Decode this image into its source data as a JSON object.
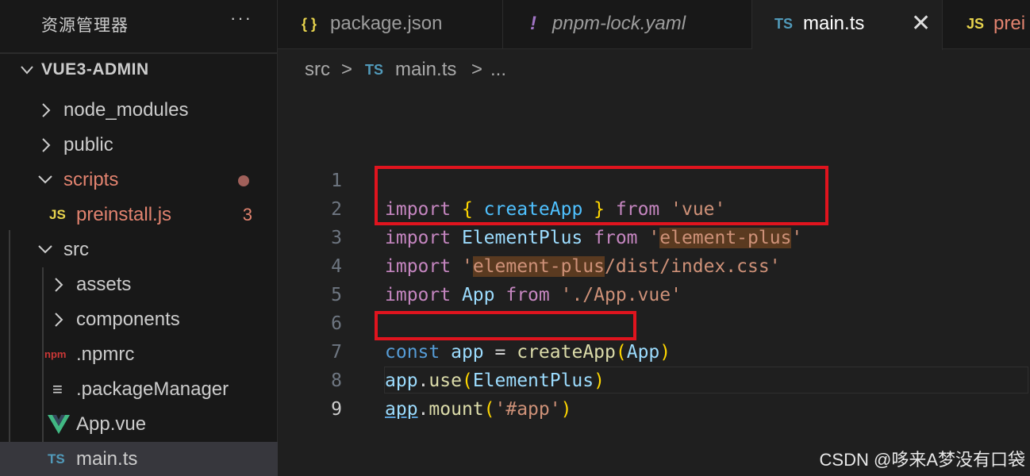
{
  "sidebar": {
    "title": "资源管理器",
    "more": "···",
    "project": "VUE3-ADMIN",
    "items": [
      {
        "label": "node_modules",
        "type": "folder",
        "open": false,
        "depth": 1
      },
      {
        "label": "public",
        "type": "folder",
        "open": false,
        "depth": 1
      },
      {
        "label": "scripts",
        "type": "folder",
        "open": true,
        "depth": 1,
        "modified": true
      },
      {
        "label": "preinstall.js",
        "type": "file",
        "icon": "JS",
        "depth": 2,
        "count": "3"
      },
      {
        "label": "src",
        "type": "folder",
        "open": true,
        "depth": 1
      },
      {
        "label": "assets",
        "type": "folder",
        "open": false,
        "depth": 2
      },
      {
        "label": "components",
        "type": "folder",
        "open": false,
        "depth": 2
      },
      {
        "label": ".npmrc",
        "type": "file",
        "icon": "npm",
        "depth": 2
      },
      {
        "label": ".packageManager",
        "type": "file",
        "icon": "≡",
        "depth": 2
      },
      {
        "label": "App.vue",
        "type": "file",
        "icon": "vue",
        "depth": 2
      },
      {
        "label": "main.ts",
        "type": "file",
        "icon": "TS",
        "depth": 2,
        "selected": true
      }
    ]
  },
  "tabs": [
    {
      "icon": "{ }",
      "label": "package.json"
    },
    {
      "icon": "!",
      "label": "pnpm-lock.yaml"
    },
    {
      "icon": "TS",
      "label": "main.ts",
      "active": true,
      "close": "✕"
    },
    {
      "icon": "JS",
      "label": "prei"
    }
  ],
  "breadcrumb": {
    "part1": "src",
    "sep": ">",
    "icon": "TS",
    "part2": "main.ts",
    "part3": "..."
  },
  "editor": {
    "line_numbers": [
      "1",
      "2",
      "3",
      "4",
      "5",
      "6",
      "7",
      "8",
      "9"
    ],
    "current_line": "9",
    "lines": {
      "l1": {
        "a": "import",
        "b": "{",
        "c": "createApp",
        "d": "}",
        "e": "from",
        "f": "'vue'"
      },
      "l2": {
        "a": "import",
        "b": "ElementPlus",
        "c": "from",
        "d": "'",
        "e": "element-plus",
        "f": "'"
      },
      "l3": {
        "a": "import",
        "b": "'",
        "c": "element-plus",
        "d": "/dist/index.css'"
      },
      "l4": {
        "a": "import",
        "b": "App",
        "c": "from",
        "d": "'./App.vue'"
      },
      "l6": {
        "a": "const",
        "b": "app",
        "c": "=",
        "d": "createApp",
        "e": "(",
        "f": "App",
        "g": ")"
      },
      "l7": {
        "a": "app",
        "b": ".",
        "c": "use",
        "d": "(",
        "e": "ElementPlus",
        "f": ")"
      },
      "l8": {
        "a": "app",
        "b": ".",
        "c": "mount",
        "d": "(",
        "e": "'#app'",
        "f": ")"
      }
    }
  },
  "watermark": "CSDN @哆来A梦没有口袋",
  "colors": {
    "keyword": "#c586c0",
    "function": "#dcdcaa",
    "variable": "#9cdcfe",
    "string": "#ce9178",
    "highlight_box": "#e0141e"
  }
}
